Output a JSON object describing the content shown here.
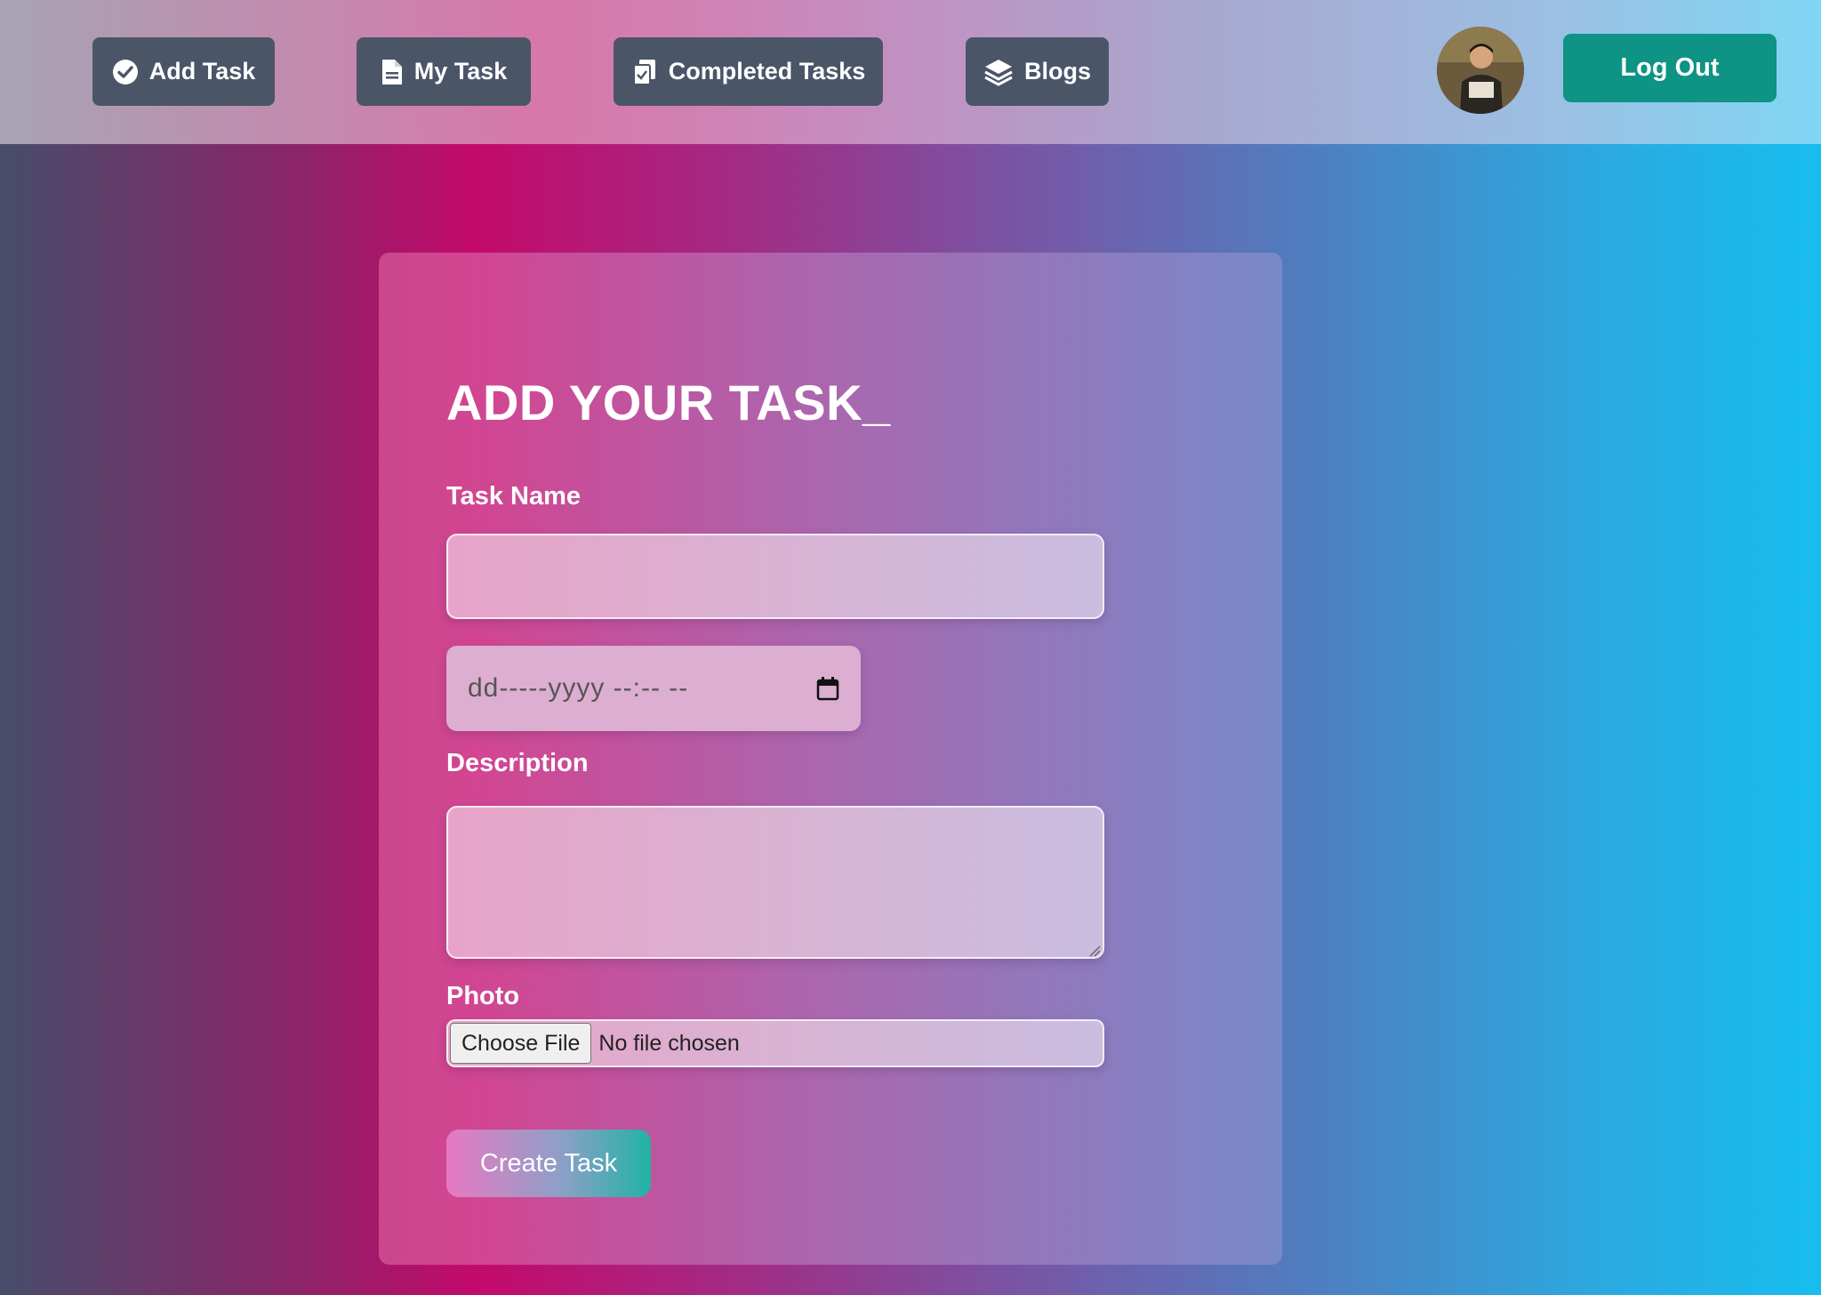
{
  "nav": {
    "add_task": {
      "label": "Add Task",
      "icon": "check-circle-icon"
    },
    "my_task": {
      "label": "My Task",
      "icon": "document-icon"
    },
    "completed_tasks": {
      "label": "Completed Tasks",
      "icon": "clipboard-check-icon"
    },
    "blogs": {
      "label": "Blogs",
      "icon": "layers-icon"
    },
    "logout_label": "Log Out"
  },
  "form": {
    "title": "ADD YOUR TASK_",
    "task_name_label": "Task Name",
    "task_name_value": "",
    "datetime_placeholder": "dd-----yyyy --:-- --",
    "description_label": "Description",
    "description_value": "",
    "photo_label": "Photo",
    "choose_file_label": "Choose File",
    "no_file_text": "No file chosen",
    "submit_label": "Create Task"
  },
  "colors": {
    "nav_button": "#4b5568",
    "logout_button": "#0e9384",
    "text_on_dark": "#ffffff"
  }
}
